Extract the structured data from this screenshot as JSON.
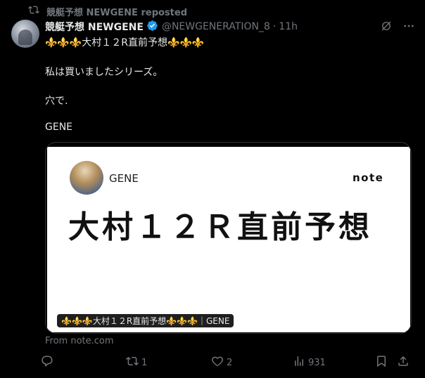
{
  "repost": {
    "label": "競艇予想  NEWGENE reposted"
  },
  "post": {
    "author_name": "競艇予想 NEWGENE",
    "handle": "@NEWGENERATION_8",
    "separator": "·",
    "time": "11h",
    "title_line": "⚜️⚜️⚜️大村１２R直前予想⚜️⚜️⚜️",
    "line2": "私は買いましたシリーズ。",
    "line3": "穴で.",
    "line4": "GENE"
  },
  "card": {
    "author": "GENE",
    "logo": "note",
    "title": "大村１２Ｒ直前予想",
    "caption": "⚜️⚜️⚜️大村１２R直前予想⚜️⚜️⚜️｜GENE",
    "source": "From note.com"
  },
  "actions": {
    "reply_count": "",
    "repost_count": "1",
    "like_count": "2",
    "view_count": "931"
  },
  "colors": {
    "background": "#000000",
    "text": "#e7e9ea",
    "muted": "#71767b",
    "verified": "#1d9bf0",
    "card_bg": "#ffffff"
  },
  "icons": [
    "repost-icon",
    "verified-badge-icon",
    "grok-icon",
    "more-icon",
    "reply-icon",
    "like-icon",
    "views-icon",
    "bookmark-icon",
    "share-icon"
  ]
}
